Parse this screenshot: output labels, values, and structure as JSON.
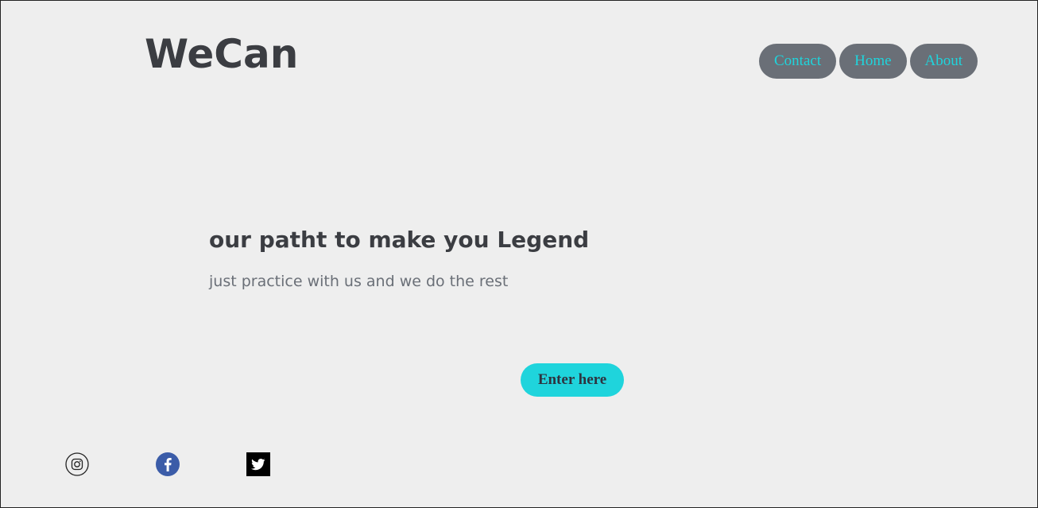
{
  "header": {
    "logo": "WeCan",
    "nav": [
      {
        "label": "Contact"
      },
      {
        "label": "Home"
      },
      {
        "label": "About"
      }
    ]
  },
  "hero": {
    "title": "our patht to make you Legend",
    "subtitle": "just practice with us and we do the rest",
    "cta_label": "Enter here"
  },
  "social": [
    {
      "icon": "instagram-icon"
    },
    {
      "icon": "facebook-icon"
    },
    {
      "icon": "twitter-icon"
    }
  ],
  "colors": {
    "background": "#eeeeee",
    "text_dark": "#3b3d42",
    "text_muted": "#6a6f77",
    "accent": "#1fd4dc",
    "nav_bg": "#6a6f77",
    "facebook": "#3b5ca8",
    "twitter_bg": "#000000"
  }
}
